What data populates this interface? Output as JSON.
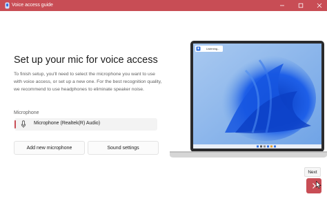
{
  "window": {
    "title": "Voice access guide",
    "accent_color": "#c84d55"
  },
  "page": {
    "heading": "Set up your mic for voice access",
    "description": "To finish setup, you'll need to select the microphone you want to use with voice access, or set up a new one. For the best recognition quality, we recommend to use headphones to eliminate speaker noise.",
    "microphone_label": "Microphone",
    "microphone_value": "Microphone (Realtek(R) Audio)"
  },
  "buttons": {
    "add_microphone": "Add new microphone",
    "sound_settings": "Sound settings",
    "next_tooltip": "Next"
  },
  "illustration": {
    "listening_text": "Listening..."
  }
}
